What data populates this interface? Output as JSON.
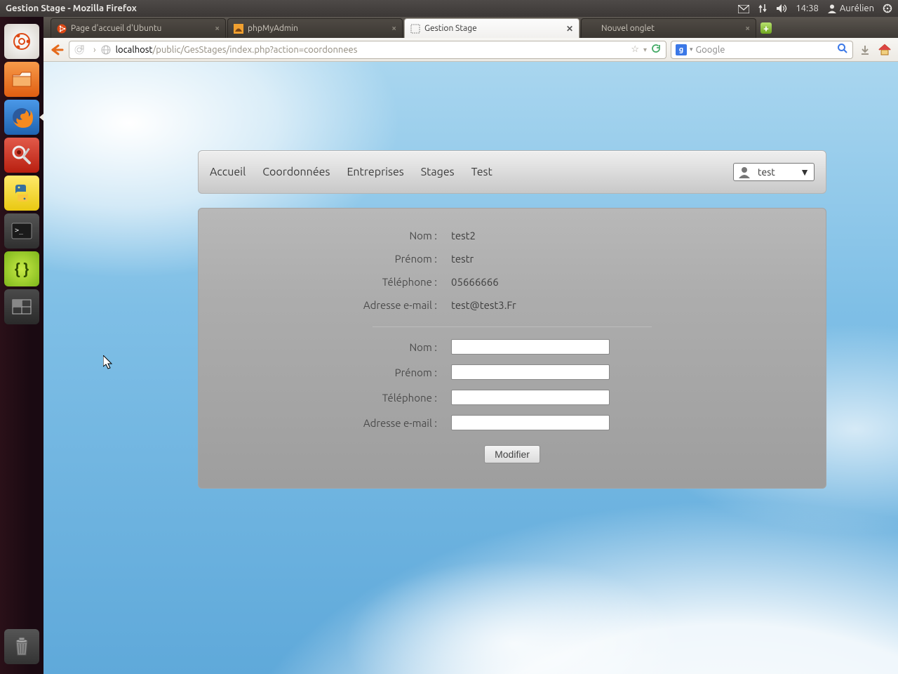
{
  "os": {
    "window_title": "Gestion Stage - Mozilla Firefox",
    "time": "14:38",
    "user": "Aurélien"
  },
  "tabs": [
    {
      "label": "Page d'accueil d'Ubuntu",
      "active": false
    },
    {
      "label": "phpMyAdmin",
      "active": false
    },
    {
      "label": "Gestion Stage",
      "active": true
    },
    {
      "label": "Nouvel onglet",
      "active": false
    }
  ],
  "url": {
    "host": "localhost",
    "path": "/public/GesStages/index.php?action=coordonnees"
  },
  "search_placeholder": "Google",
  "nav": {
    "items": [
      "Accueil",
      "Coordonnées",
      "Entreprises",
      "Stages",
      "Test"
    ],
    "user_selected": "test"
  },
  "info": {
    "labels": {
      "nom": "Nom :",
      "prenom": "Prénom :",
      "tel": "Téléphone :",
      "email": "Adresse e-mail :"
    },
    "values": {
      "nom": "test2",
      "prenom": "testr",
      "tel": "05666666",
      "email": "test@test3.Fr"
    }
  },
  "form": {
    "labels": {
      "nom": "Nom :",
      "prenom": "Prénom :",
      "tel": "Téléphone :",
      "email": "Adresse e-mail :"
    },
    "values": {
      "nom": "",
      "prenom": "",
      "tel": "",
      "email": ""
    },
    "submit": "Modifier"
  }
}
